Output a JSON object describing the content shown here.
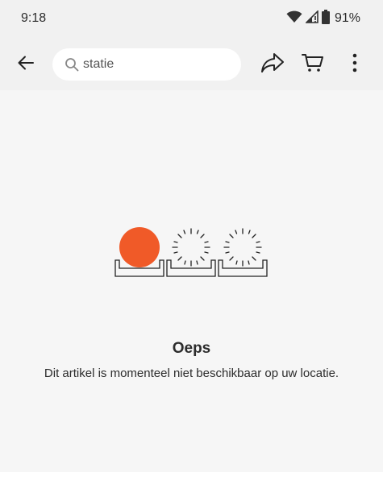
{
  "status_bar": {
    "time": "9:18",
    "battery_percent": "91%",
    "icons": [
      "wifi-icon",
      "cell-signal-icon",
      "battery-icon"
    ]
  },
  "toolbar": {
    "back_icon": "arrow-left-icon",
    "search_value": "statie",
    "share_icon": "share-icon",
    "cart_icon": "cart-icon",
    "more_icon": "more-vertical-icon"
  },
  "empty_state": {
    "title": "Oeps",
    "message": "Dit artikel is momenteel niet beschikbaar op uw locatie."
  },
  "colors": {
    "accent": "#f05a28",
    "bar_background": "#f1f1f1",
    "content_background": "#f6f6f6"
  }
}
